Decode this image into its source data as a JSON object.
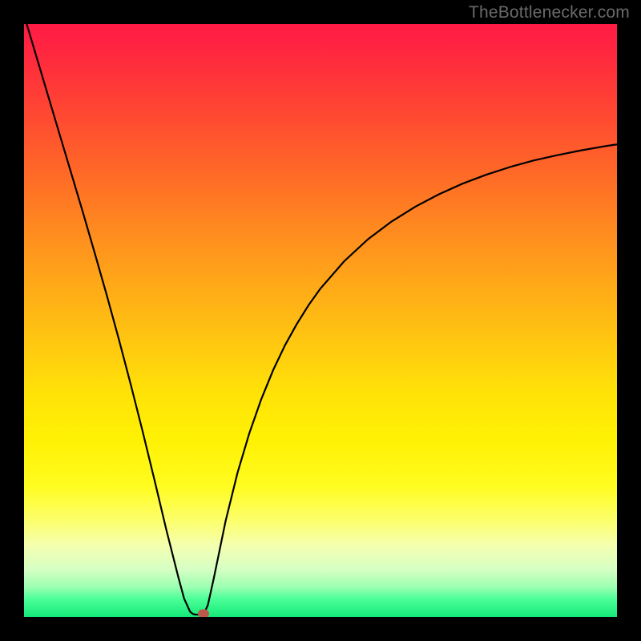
{
  "attribution": "TheBottlenecker.com",
  "colors": {
    "curve_stroke": "#000000",
    "marker_fill": "#bb5a4a",
    "frame": "#000000"
  },
  "chart_data": {
    "type": "line",
    "title": "",
    "xlabel": "",
    "ylabel": "",
    "x": [
      0,
      0.02,
      0.04,
      0.06,
      0.08,
      0.1,
      0.12,
      0.14,
      0.16,
      0.18,
      0.2,
      0.22,
      0.24,
      0.26,
      0.27,
      0.28,
      0.285,
      0.29,
      0.295,
      0.3,
      0.305,
      0.31,
      0.32,
      0.34,
      0.36,
      0.38,
      0.4,
      0.42,
      0.44,
      0.46,
      0.48,
      0.5,
      0.54,
      0.58,
      0.62,
      0.66,
      0.7,
      0.74,
      0.78,
      0.82,
      0.86,
      0.9,
      0.94,
      0.98,
      1.0
    ],
    "values": [
      1.015,
      0.948,
      0.881,
      0.814,
      0.747,
      0.68,
      0.611,
      0.541,
      0.468,
      0.392,
      0.313,
      0.231,
      0.147,
      0.068,
      0.031,
      0.009,
      0.005,
      0.004,
      0.004,
      0.005,
      0.009,
      0.02,
      0.065,
      0.162,
      0.243,
      0.31,
      0.367,
      0.416,
      0.458,
      0.494,
      0.526,
      0.554,
      0.6,
      0.637,
      0.667,
      0.692,
      0.713,
      0.731,
      0.746,
      0.759,
      0.77,
      0.779,
      0.787,
      0.794,
      0.797
    ],
    "xlim": [
      0,
      1
    ],
    "ylim": [
      0,
      1
    ],
    "marker": {
      "x": 0.303,
      "y": 0.006
    },
    "axes_visible": false,
    "background": "rainbow-vertical-gradient"
  }
}
